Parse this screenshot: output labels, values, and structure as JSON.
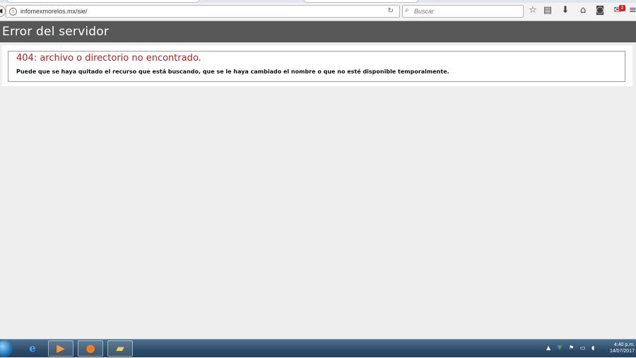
{
  "browser": {
    "url": "infomexmorelos.mx/sie/",
    "search_placeholder": "Buscar",
    "notification_count": "2"
  },
  "icons": {
    "back": "back-arrow-icon",
    "info": "info-icon",
    "reload": "reload-icon",
    "search": "search-icon",
    "bookmark": "star-icon",
    "reading_list": "library-icon",
    "downloads": "download-icon",
    "home": "home-icon",
    "pocket": "pocket-icon",
    "notifications": "notification-icon",
    "menu": "menu-icon"
  },
  "page": {
    "header_title": "Error del servidor",
    "error_title": "404: archivo o directorio no encontrado.",
    "error_message": "Puede que se haya quitado el recurso que está buscando, que se le haya cambiado el nombre o que no esté disponible temporalmente."
  },
  "taskbar": {
    "apps": [
      "internet-explorer",
      "media-player",
      "firefox",
      "file-explorer"
    ],
    "clock_time": "4:40 p.m.",
    "clock_date": "14/07/2017"
  },
  "colors": {
    "header_bg": "#575757",
    "error_title": "#b3201c",
    "page_bg": "#eeeeee"
  }
}
